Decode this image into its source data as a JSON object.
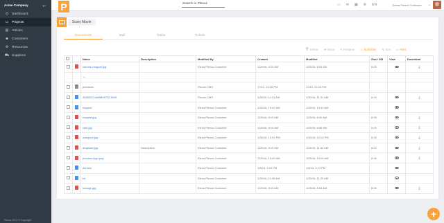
{
  "sidebar": {
    "company": "Acme Company",
    "back_icon": "arrow-left-icon",
    "items": [
      {
        "label": "Dashboard",
        "icon": "dashboard-icon"
      },
      {
        "label": "Projects",
        "icon": "folder-icon",
        "active": true
      },
      {
        "label": "Articles",
        "icon": "article-icon"
      },
      {
        "label": "Customers",
        "icon": "users-icon"
      },
      {
        "label": "Resources",
        "icon": "gear-icon"
      },
      {
        "label": "Suppliers",
        "icon": "truck-icon"
      }
    ],
    "footer": "Plexus 2014 © Copyright"
  },
  "topbar": {
    "logo": "P",
    "search_placeholder": "Search in Plexus",
    "lang": "EN",
    "user": "Elena Plexus Customer"
  },
  "project": {
    "title": "Scary Movie",
    "tabs": [
      "Documents",
      "Mail",
      "Tasks",
      "Tickets"
    ],
    "active_tab": 0,
    "actions": [
      "Delete",
      "Move",
      "Rename",
      "Subfolder",
      "Sort",
      "Files"
    ]
  },
  "table": {
    "headers": [
      "",
      "",
      "Name",
      "Description",
      "Modified By",
      "Created",
      "Modified",
      "Size / KB",
      "View",
      "Download"
    ],
    "rows": [
      {
        "type": "jpg",
        "name": "cannes-redgoaf.jpg",
        "desc": "",
        "by": "Elena Plexus Customer",
        "created": "12/5/16, 9:19 AM",
        "modified": "12/5/16, 8:54 AM",
        "size": "8.05",
        "view": true,
        "download": true
      },
      {
        "type": "back",
        "name": "",
        "desc": "",
        "by": "",
        "created": "",
        "modified": "",
        "size": "",
        "view": false,
        "download": false
      },
      {
        "type": "folder",
        "name": "previews",
        "desc": "",
        "by": "Plexus CMS",
        "created": "17/12, 12:16 PM",
        "modified": "17/12, 12:16 PM",
        "size": "",
        "view": false,
        "download": false
      },
      {
        "type": "doc",
        "name": "4546D1C1689B09733.SMS",
        "desc": "",
        "by": "Plexus CMS",
        "created": "1/30/16, 11:31 AM",
        "modified": "1/30/16, 11:31 AM",
        "size": "8.04",
        "view": true,
        "download": true
      },
      {
        "type": "doc",
        "name": "request",
        "desc": "",
        "by": "Elena Plexus Customer",
        "created": "1/25/16, 10:40 AM",
        "modified": "1/25/16, 10:40 AM",
        "size": "",
        "view": true,
        "download": false
      },
      {
        "type": "jpg",
        "name": "request.jpg",
        "desc": "",
        "by": "Elena Plexus Customer",
        "created": "12/5/16, 8:19 AM",
        "modified": "12/5/16, 8:40 AM",
        "size": "8.05",
        "view": true,
        "download": true
      },
      {
        "type": "jpg",
        "name": "cast.jpg",
        "desc": "",
        "by": "Elena Plexus Customer",
        "created": "12/5/16, 8:19 AM",
        "modified": "12/5/16, 8:56 AM",
        "size": "8.05",
        "view": true,
        "download": true
      },
      {
        "type": "jpg",
        "name": "marquee.jpg",
        "desc": "",
        "by": "Elena Plexus Customer",
        "created": "1/30/16, 12:02 PM",
        "modified": "1/30/16, 12:02 PM",
        "size": "8.05",
        "view": true,
        "download": true
      },
      {
        "type": "jpg",
        "name": "drapload.jpg",
        "desc": "Description",
        "by": "Elena Plexus Customer",
        "created": "12/5/16, 8:19 AM",
        "modified": "12/5/16, 11:44 AM",
        "size": "8.02",
        "view": true,
        "download": true
      },
      {
        "type": "jpg",
        "name": "preview-logo.png",
        "desc": "",
        "by": "Elena Plexus Customer",
        "created": "12/5/16, 10:00 AM",
        "modified": "12/5/16, 10:00 AM",
        "size": "8.06",
        "view": true,
        "download": true
      },
      {
        "type": "doc",
        "name": "did.tsto",
        "desc": "",
        "by": "Elena Plexus Customer",
        "created": "1/8/15, 2:19 PM",
        "modified": "1/8/15, 2:19 PM",
        "size": "",
        "view": true,
        "download": false
      },
      {
        "type": "doc",
        "name": "txt",
        "desc": "",
        "by": "Elena Plexus Customer",
        "created": "1/25/16, 11:29 AM",
        "modified": "1/25/16, 11:29 AM",
        "size": "",
        "view": true,
        "download": false
      },
      {
        "type": "jpg",
        "name": "icmage.jpg",
        "desc": "",
        "by": "Elena Plexus Customer",
        "created": "12/5/16, 8:19 AM",
        "modified": "12/5/16, 8:54 AM",
        "size": "8.05",
        "view": true,
        "download": true
      }
    ]
  },
  "fab": "+",
  "colors": {
    "accent": "#f7a23b",
    "sidebar": "#2f3a45",
    "link": "#3a7bd5"
  }
}
